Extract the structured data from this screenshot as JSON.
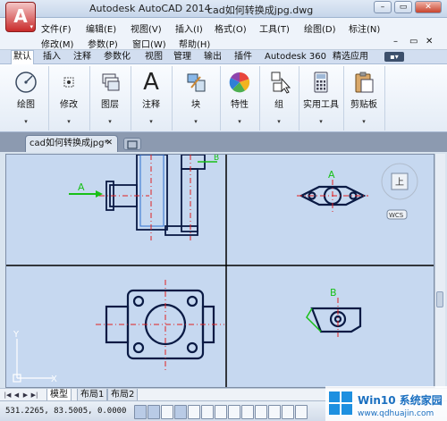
{
  "window": {
    "app_title": "Autodesk AutoCAD 2014",
    "document_title": "cad如何转换成jpg.dwg",
    "app_button": "A",
    "minimize": "–",
    "restore": "▭",
    "close": "✕"
  },
  "menu": {
    "row1": [
      {
        "label": "文件(F)"
      },
      {
        "label": "编辑(E)"
      },
      {
        "label": "视图(V)"
      },
      {
        "label": "插入(I)"
      },
      {
        "label": "格式(O)"
      },
      {
        "label": "工具(T)"
      },
      {
        "label": "绘图(D)"
      },
      {
        "label": "标注(N)"
      }
    ],
    "row2": [
      {
        "label": "修改(M)"
      },
      {
        "label": "参数(P)"
      },
      {
        "label": "窗口(W)"
      },
      {
        "label": "帮助(H)"
      }
    ],
    "mini_controls": [
      "–",
      "▭",
      "✕"
    ]
  },
  "ribbon_tabs": [
    {
      "label": "默认",
      "active": true
    },
    {
      "label": "插入"
    },
    {
      "label": "注释"
    },
    {
      "label": "参数化"
    },
    {
      "label": "视图"
    },
    {
      "label": "管理"
    },
    {
      "label": "输出"
    },
    {
      "label": "插件"
    },
    {
      "label": "Autodesk 360"
    },
    {
      "label": "精选应用"
    }
  ],
  "ribbon_more": "▪▾",
  "ribbon_groups": [
    {
      "label": "绘图",
      "icon": "draw-icon"
    },
    {
      "label": "修改",
      "icon": "modify-icon"
    },
    {
      "label": "图层",
      "icon": "layers-icon"
    },
    {
      "label": "注释",
      "icon": "annotation-icon",
      "glyph": "A"
    },
    {
      "label": "块",
      "icon": "block-icon"
    },
    {
      "label": "特性",
      "icon": "properties-icon"
    },
    {
      "label": "组",
      "icon": "group-icon"
    },
    {
      "label": "实用工具",
      "icon": "utilities-icon"
    },
    {
      "label": "剪贴板",
      "icon": "clipboard-icon"
    }
  ],
  "ribbon_dropdown_glyph": "▾",
  "document_tab": {
    "label": "cad如何转换成jpg*",
    "close": "✕"
  },
  "viewcube": {
    "face": "上",
    "wcs": "WCS"
  },
  "drawing_labels": {
    "section_a": "A",
    "section_b": "B",
    "axis_x": "X",
    "axis_y": "Y"
  },
  "layout_tabs": [
    {
      "label": "模型",
      "active": true
    },
    {
      "label": "布局1"
    },
    {
      "label": "布局2"
    }
  ],
  "layout_nav": [
    "|◀",
    "◀",
    "▶",
    "▶|"
  ],
  "status": {
    "coordinates": "531.2265, 83.5005, 0.0000"
  },
  "watermark": {
    "brand": "Win10 系统家园",
    "url": "www.qdhuajin.com"
  },
  "colors": {
    "app_red": "#c92b2b",
    "drawing_bg": "#c6d8f0",
    "outline": "#0a1a44",
    "center_line": "#e02020",
    "dim_green": "#18c018",
    "hatch": "#2f6fd0"
  }
}
